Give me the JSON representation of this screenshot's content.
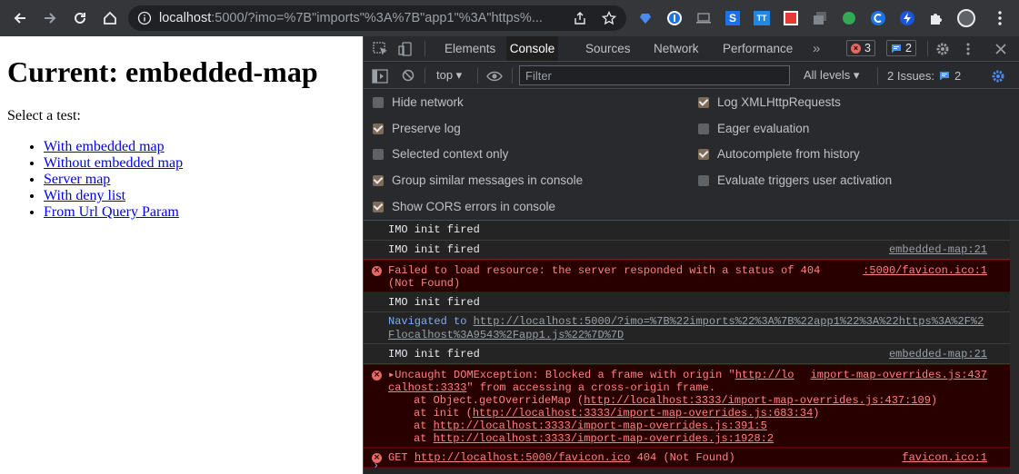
{
  "browser": {
    "url_host": "localhost",
    "url_rest": ":5000/?imo=%7B\"imports\"%3A%7B\"app1\"%3A\"https%..."
  },
  "page": {
    "heading": "Current: embedded-map",
    "prompt": "Select a test:",
    "links": [
      "With embedded map",
      "Without embedded map",
      "Server map",
      "With deny list",
      "From Url Query Param"
    ]
  },
  "devtools": {
    "tabs": [
      "Elements",
      "Console",
      "Sources",
      "Network",
      "Performance"
    ],
    "more_tabs": "»",
    "error_count": "3",
    "message_count": "2",
    "context": "top ▾",
    "filter_placeholder": "Filter",
    "levels": "All levels ▾",
    "issues": "2 Issues:",
    "issues_count": "2",
    "settings_left": [
      {
        "label": "Hide network",
        "checked": false
      },
      {
        "label": "Preserve log",
        "checked": true
      },
      {
        "label": "Selected context only",
        "checked": false
      },
      {
        "label": "Group similar messages in console",
        "checked": true
      },
      {
        "label": "Show CORS errors in console",
        "checked": true
      }
    ],
    "settings_right": [
      {
        "label": "Log XMLHttpRequests",
        "checked": true
      },
      {
        "label": "Eager evaluation",
        "checked": false
      },
      {
        "label": "Autocomplete from history",
        "checked": true
      },
      {
        "label": "Evaluate triggers user activation",
        "checked": false
      }
    ]
  },
  "console": {
    "m1": "IMO init fired",
    "m2": "IMO init fired",
    "m2_src": "embedded-map:21",
    "m3_l1": "Failed to load resource: the server responded with a status of 404",
    "m3_l2": "(Not Found)",
    "m3_src": ":5000/favicon.ico:1",
    "m4": "IMO init fired",
    "m5_prefix": "Navigated to ",
    "m5_l1": "http://localhost:5000/?imo=%7B%22imports%22%3A%7B%22app1%22%3A%22https%3A%2F%2",
    "m5_l2": "Flocalhost%3A9543%2Fapp1.js%22%7D%7D",
    "m6": "IMO init fired",
    "m6_src": "embedded-map:21",
    "m7_l1a": "▸Uncaught DOMException: Blocked a frame with origin \"",
    "m7_l1b": "http://lo",
    "m7_l2a": "calhost:3333",
    "m7_l2b": "\" from accessing a cross-origin frame.",
    "m7_src": "import-map-overrides.js:437",
    "stack": [
      {
        "pre": "at Object.getOverrideMap (",
        "link": "http://localhost:3333/import-map-overrides.js:437:109",
        "post": ")"
      },
      {
        "pre": "at init (",
        "link": "http://localhost:3333/import-map-overrides.js:683:34",
        "post": ")"
      },
      {
        "pre": "at ",
        "link": "http://localhost:3333/import-map-overrides.js:391:5",
        "post": ""
      },
      {
        "pre": "at ",
        "link": "http://localhost:3333/import-map-overrides.js:1928:2",
        "post": ""
      }
    ],
    "m8_a": "GET ",
    "m8_link": "http://localhost:5000/favicon.ico",
    "m8_b": " 404 (Not Found)",
    "m8_src": "favicon.ico:1"
  }
}
